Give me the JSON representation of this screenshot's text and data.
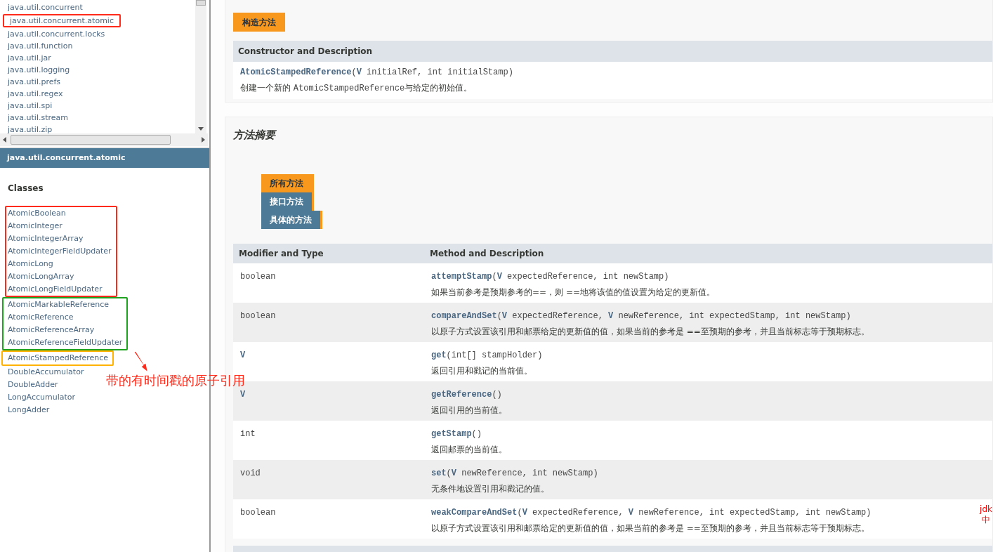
{
  "packages": [
    {
      "name": "java.util.concurrent",
      "framed": false
    },
    {
      "name": "java.util.concurrent.atomic",
      "framed": true
    },
    {
      "name": "java.util.concurrent.locks",
      "framed": false
    },
    {
      "name": "java.util.function",
      "framed": false
    },
    {
      "name": "java.util.jar",
      "framed": false
    },
    {
      "name": "java.util.logging",
      "framed": false
    },
    {
      "name": "java.util.prefs",
      "framed": false
    },
    {
      "name": "java.util.regex",
      "framed": false
    },
    {
      "name": "java.util.spi",
      "framed": false
    },
    {
      "name": "java.util.stream",
      "framed": false
    },
    {
      "name": "java.util.zip",
      "framed": false
    }
  ],
  "package_title": "java.util.concurrent.atomic",
  "classes_heading": "Classes",
  "class_groups": [
    {
      "color": "#ff2a1a",
      "classes": [
        "AtomicBoolean",
        "AtomicInteger",
        "AtomicIntegerArray",
        "AtomicIntegerFieldUpdater",
        "AtomicLong",
        "AtomicLongArray",
        "AtomicLongFieldUpdater"
      ]
    },
    {
      "color": "#1fa21f",
      "classes": [
        "AtomicMarkableReference",
        "AtomicReference",
        "AtomicReferenceArray",
        "AtomicReferenceFieldUpdater"
      ]
    },
    {
      "color": "#ffb300",
      "classes": [
        "AtomicStampedReference"
      ]
    },
    {
      "classes": [
        "DoubleAccumulator",
        "DoubleAdder",
        "LongAccumulator",
        "LongAdder"
      ]
    }
  ],
  "annotation": "带的有时间戳的原子引用",
  "side_note": [
    "jdk",
    "中"
  ],
  "constructor_section": {
    "tab": "构造方法",
    "header": "Constructor and Description",
    "name": "AtomicStampedReference",
    "params": "(**V** initialRef, int initialStamp)",
    "desc_before": "创建一个新的 ",
    "desc_code": "AtomicStampedReference",
    "desc_after": "与给定的初始值。"
  },
  "method_section": {
    "title": "方法摘要",
    "tabs": [
      {
        "label": "所有方法",
        "selected": true
      },
      {
        "label": "接口方法",
        "selected": false
      },
      {
        "label": "具体的方法",
        "selected": false
      }
    ],
    "columns": [
      "Modifier and Type",
      "Method and Description"
    ],
    "rows": [
      {
        "type": "boolean",
        "name": "attemptStamp",
        "params": "(**V** expectedReference, int newStamp)",
        "desc": "如果当前参考是预期参考的==，则 ==地将该值的值设置为给定的更新值。"
      },
      {
        "type": "boolean",
        "name": "compareAndSet",
        "params": "(**V** expectedReference, **V** newReference, int expectedStamp, int newStamp)",
        "desc": "以原子方式设置该引用和邮票给定的更新值的值，如果当前的参考是 ==至预期的参考，并且当前标志等于预期标志。"
      },
      {
        "type": "**V**",
        "name": "get",
        "params": "(int[] stampHolder)",
        "desc": "返回引用和戳记的当前值。"
      },
      {
        "type": "**V**",
        "name": "getReference",
        "params": "()",
        "desc": "返回引用的当前值。"
      },
      {
        "type": "int",
        "name": "getStamp",
        "params": "()",
        "desc": "返回邮票的当前值。"
      },
      {
        "type": "void",
        "name": "set",
        "params": "(**V** newReference, int newStamp)",
        "desc": "无条件地设置引用和戳记的值。"
      },
      {
        "type": "boolean",
        "name": "weakCompareAndSet",
        "params": "(**V** expectedReference, **V** newReference, int expectedStamp, int newStamp)",
        "desc": "以原子方式设置该引用和邮票给定的更新值的值，如果当前的参考是 ==至预期的参考，并且当前标志等于预期标志。"
      }
    ]
  }
}
